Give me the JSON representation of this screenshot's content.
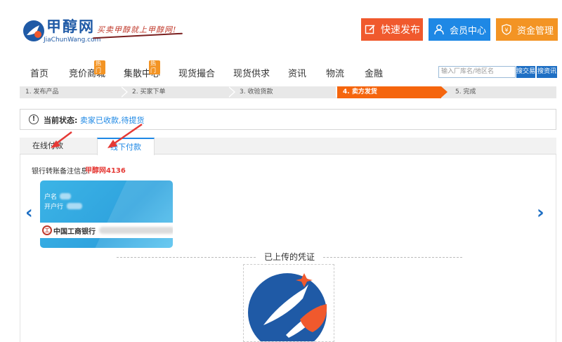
{
  "header": {
    "logo_cn": "甲醇网",
    "logo_en": "JiaChunWang.com",
    "slogan": "买卖甲醇就上甲醇网!",
    "buttons": {
      "publish": "快速发布",
      "member": "会员中心",
      "funds": "资金管理"
    }
  },
  "nav": {
    "items": [
      {
        "label": "首页"
      },
      {
        "label": "竞价商城",
        "badge": "热门"
      },
      {
        "label": "集散中心",
        "badge": "热门"
      },
      {
        "label": "现货撮合"
      },
      {
        "label": "现货供求"
      },
      {
        "label": "资讯"
      },
      {
        "label": "物流"
      },
      {
        "label": "金融"
      }
    ],
    "search": {
      "placeholder": "输入厂库名/地区名",
      "btn_trade": "搜交易",
      "btn_info": "搜资讯"
    }
  },
  "steps": {
    "items": [
      "1. 发布产品",
      "2. 买家下单",
      "3. 收验货款",
      "4. 卖方发货",
      "5. 完成"
    ],
    "active_index": 3
  },
  "status": {
    "label": "当前状态:",
    "value": "卖家已收款,待提货"
  },
  "tabs": {
    "online": "在线付款",
    "offline": "线下付款",
    "active": "offline"
  },
  "remark": {
    "label": "银行转账备注信息:",
    "value": "甲醇网4136"
  },
  "bank_card": {
    "holder_label": "户名",
    "bank_branch_label": "开户行",
    "bank_name": "中国工商银行"
  },
  "voucher": {
    "title": "已上传的凭证"
  },
  "colors": {
    "brand_blue": "#1e88e5",
    "publish_orange": "#f0592d",
    "funds_orange": "#f39424",
    "step_active": "#f5650d",
    "annotation_red": "#e53935"
  },
  "icons": {
    "publish": "edit-icon",
    "member": "user-icon",
    "funds": "shield-yen-icon",
    "status": "info-icon",
    "carousel_prev": "chevron-left-icon",
    "carousel_next": "chevron-right-icon"
  }
}
